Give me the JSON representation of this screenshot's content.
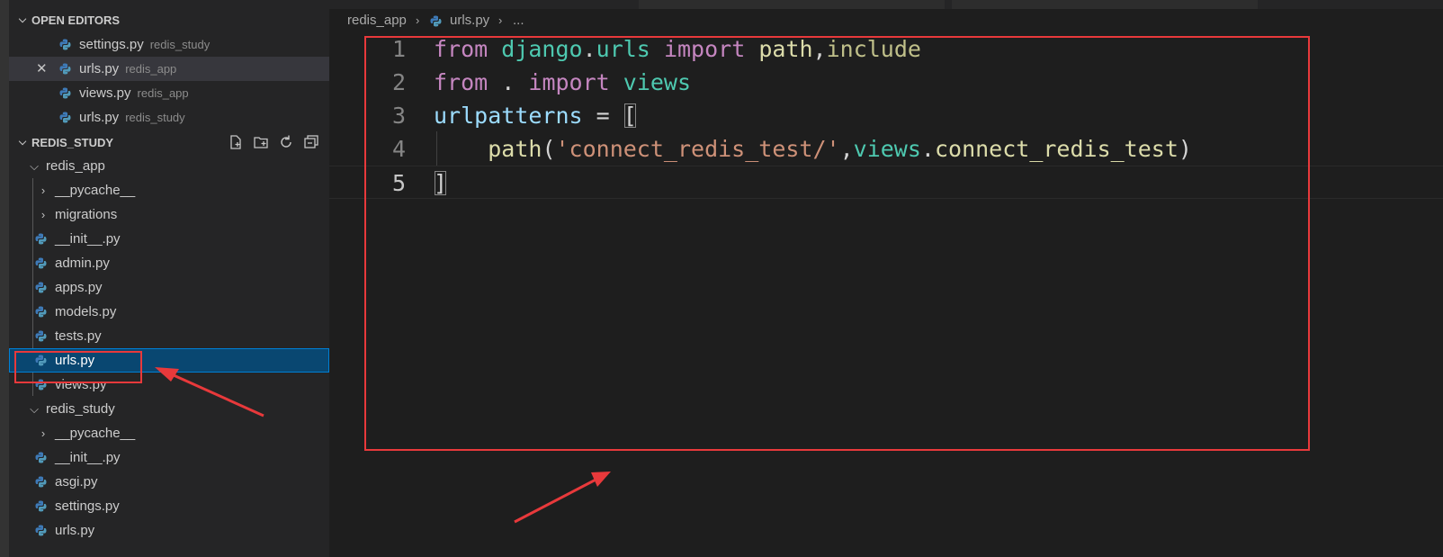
{
  "sidebar": {
    "open_editors": {
      "title": "OPEN EDITORS",
      "items": [
        {
          "name": "settings.py",
          "desc": "redis_study"
        },
        {
          "name": "urls.py",
          "desc": "redis_app",
          "close": "✕"
        },
        {
          "name": "views.py",
          "desc": "redis_app"
        },
        {
          "name": "urls.py",
          "desc": "redis_study"
        }
      ]
    },
    "explorer": {
      "title": "REDIS_STUDY",
      "actions": [
        "new-file-icon",
        "new-folder-icon",
        "refresh-icon",
        "collapse-all-icon"
      ],
      "tree": {
        "redis_app": "redis_app",
        "pycache1": "__pycache__",
        "migrations": "migrations",
        "init1": "__init__.py",
        "admin": "admin.py",
        "apps": "apps.py",
        "models": "models.py",
        "tests": "tests.py",
        "urls1": "urls.py",
        "views": "views.py",
        "redis_study": "redis_study",
        "pycache2": "__pycache__",
        "init2": "__init__.py",
        "asgi": "asgi.py",
        "settings": "settings.py",
        "urls2": "urls.py"
      }
    }
  },
  "breadcrumb": {
    "folder": "redis_app",
    "file": "urls.py",
    "more": "..."
  },
  "editor": {
    "line_numbers": [
      "1",
      "2",
      "3",
      "4",
      "5"
    ],
    "tokens": {
      "l1_from": "from",
      "l1_mod": "django",
      "l1_dot": ".",
      "l1_mod2": "urls",
      "l1_import": "import",
      "l1_path": "path",
      "l1_comma": ",",
      "l1_include": "include",
      "l2_from": "from",
      "l2_dot": ".",
      "l2_import": "import",
      "l2_views": "views",
      "l3_var": "urlpatterns",
      "l3_eq": "=",
      "l3_br": "[",
      "l4_fn": "path",
      "l4_open": "(",
      "l4_str": "'connect_redis_test/'",
      "l4_comma": ",",
      "l4_views": "views",
      "l4_dot": ".",
      "l4_attr": "connect_redis_test",
      "l4_close": ")",
      "l5_br": "]"
    }
  },
  "colors": {
    "keyword": "#c586c0",
    "module": "#4ec9b0",
    "function": "#dcdcaa",
    "variable": "#9cdcfe",
    "string": "#ce9178",
    "annotation": "#e8393b",
    "selection": "#094771"
  }
}
